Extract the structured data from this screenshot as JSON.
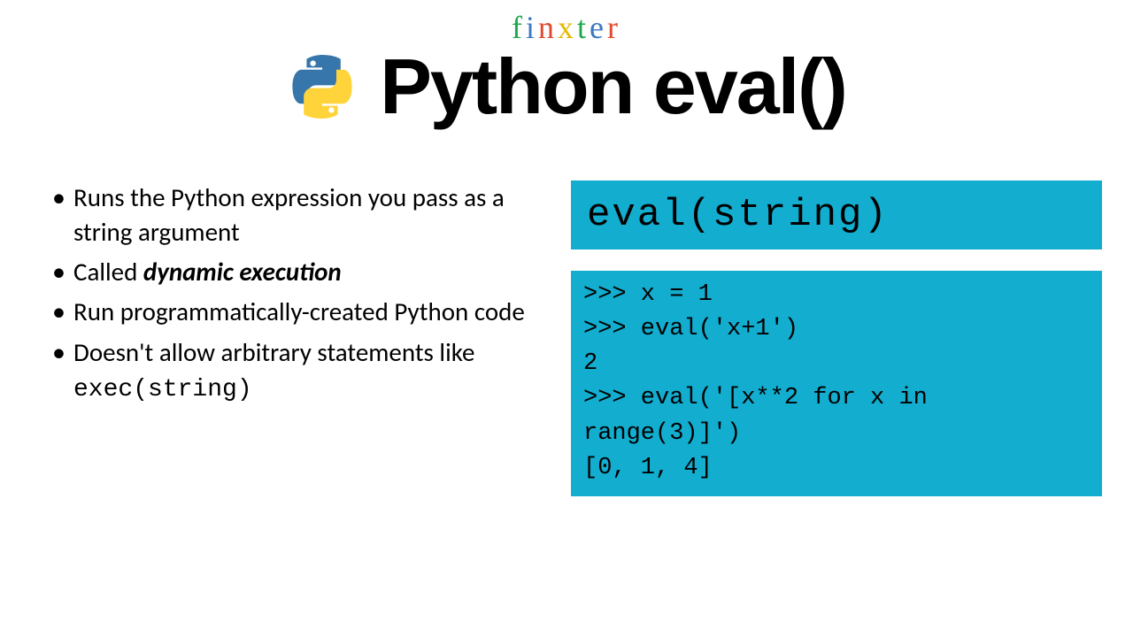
{
  "logo": {
    "chars": [
      {
        "c": "f",
        "color": "#1fa94a"
      },
      {
        "c": "i",
        "color": "#3c78c3"
      },
      {
        "c": "n",
        "color": "#e04a2f"
      },
      {
        "c": "x",
        "color": "#e6b800"
      },
      {
        "c": "t",
        "color": "#1fa94a"
      },
      {
        "c": "e",
        "color": "#3c78c3"
      },
      {
        "c": "r",
        "color": "#e04a2f"
      }
    ]
  },
  "title": "Python eval()",
  "bullets": [
    {
      "pre": "Runs the Python expression you pass as a string argument"
    },
    {
      "pre": "Called ",
      "strong": "dynamic execution"
    },
    {
      "pre": "Run programmatically-created Python code"
    },
    {
      "pre": "Doesn't allow arbitrary statements like ",
      "mono": "exec(string)"
    }
  ],
  "code_header": "eval(string)",
  "code_block": ">>> x = 1\n>>> eval('x+1')\n2\n>>> eval('[x**2 for x in range(3)]')\n[0, 1, 4]"
}
